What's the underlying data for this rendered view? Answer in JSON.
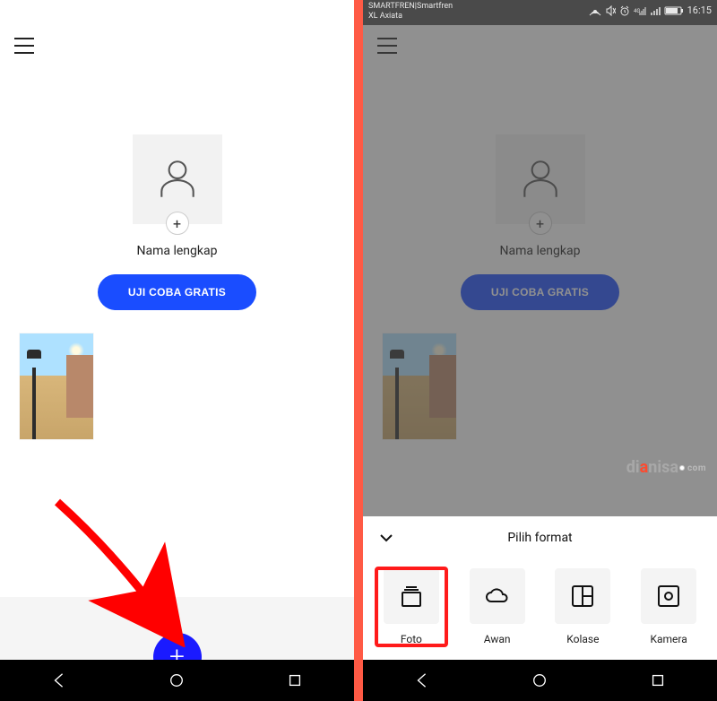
{
  "left": {
    "profile": {
      "name_placeholder": "Nama lengkap",
      "add_symbol": "+"
    },
    "cta_label": "UJI COBA GRATIS",
    "fab_symbol": "+"
  },
  "right": {
    "status_bar": {
      "carrier_line1": "SMARTFREN|Smartfren",
      "carrier_line2": "XL Axiata",
      "time": "16:15"
    },
    "profile": {
      "name_placeholder": "Nama lengkap",
      "add_symbol": "+"
    },
    "cta_label": "UJI COBA GRATIS",
    "sheet": {
      "title": "Pilih format",
      "options": [
        {
          "label": "Foto"
        },
        {
          "label": "Awan"
        },
        {
          "label": "Kolase"
        },
        {
          "label": "Kamera"
        }
      ]
    },
    "watermark": {
      "brand_a": "di",
      "brand_b": "a",
      "brand_c": "nisa",
      "suffix": "com"
    }
  }
}
